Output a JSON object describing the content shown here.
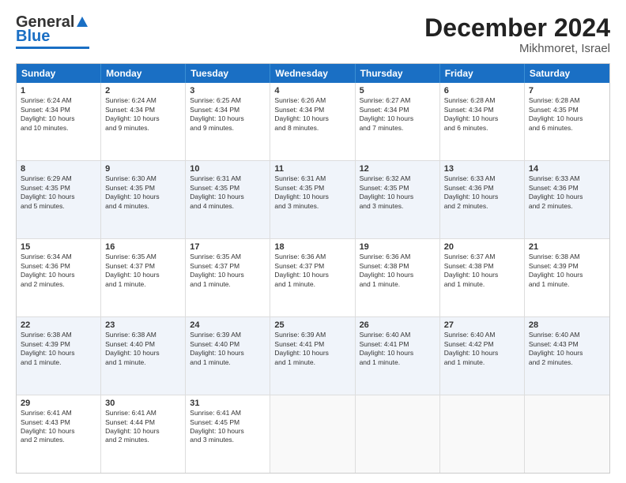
{
  "header": {
    "logo_general": "General",
    "logo_blue": "Blue",
    "title": "December 2024",
    "location": "Mikhmoret, Israel"
  },
  "days_of_week": [
    "Sunday",
    "Monday",
    "Tuesday",
    "Wednesday",
    "Thursday",
    "Friday",
    "Saturday"
  ],
  "weeks": [
    [
      {
        "day": "1",
        "sunrise": "6:24 AM",
        "sunset": "4:34 PM",
        "daylight": "10 hours and 10 minutes."
      },
      {
        "day": "2",
        "sunrise": "6:24 AM",
        "sunset": "4:34 PM",
        "daylight": "10 hours and 9 minutes."
      },
      {
        "day": "3",
        "sunrise": "6:25 AM",
        "sunset": "4:34 PM",
        "daylight": "10 hours and 9 minutes."
      },
      {
        "day": "4",
        "sunrise": "6:26 AM",
        "sunset": "4:34 PM",
        "daylight": "10 hours and 8 minutes."
      },
      {
        "day": "5",
        "sunrise": "6:27 AM",
        "sunset": "4:34 PM",
        "daylight": "10 hours and 7 minutes."
      },
      {
        "day": "6",
        "sunrise": "6:28 AM",
        "sunset": "4:34 PM",
        "daylight": "10 hours and 6 minutes."
      },
      {
        "day": "7",
        "sunrise": "6:28 AM",
        "sunset": "4:35 PM",
        "daylight": "10 hours and 6 minutes."
      }
    ],
    [
      {
        "day": "8",
        "sunrise": "6:29 AM",
        "sunset": "4:35 PM",
        "daylight": "10 hours and 5 minutes."
      },
      {
        "day": "9",
        "sunrise": "6:30 AM",
        "sunset": "4:35 PM",
        "daylight": "10 hours and 4 minutes."
      },
      {
        "day": "10",
        "sunrise": "6:31 AM",
        "sunset": "4:35 PM",
        "daylight": "10 hours and 4 minutes."
      },
      {
        "day": "11",
        "sunrise": "6:31 AM",
        "sunset": "4:35 PM",
        "daylight": "10 hours and 3 minutes."
      },
      {
        "day": "12",
        "sunrise": "6:32 AM",
        "sunset": "4:35 PM",
        "daylight": "10 hours and 3 minutes."
      },
      {
        "day": "13",
        "sunrise": "6:33 AM",
        "sunset": "4:36 PM",
        "daylight": "10 hours and 2 minutes."
      },
      {
        "day": "14",
        "sunrise": "6:33 AM",
        "sunset": "4:36 PM",
        "daylight": "10 hours and 2 minutes."
      }
    ],
    [
      {
        "day": "15",
        "sunrise": "6:34 AM",
        "sunset": "4:36 PM",
        "daylight": "10 hours and 2 minutes."
      },
      {
        "day": "16",
        "sunrise": "6:35 AM",
        "sunset": "4:37 PM",
        "daylight": "10 hours and 1 minute."
      },
      {
        "day": "17",
        "sunrise": "6:35 AM",
        "sunset": "4:37 PM",
        "daylight": "10 hours and 1 minute."
      },
      {
        "day": "18",
        "sunrise": "6:36 AM",
        "sunset": "4:37 PM",
        "daylight": "10 hours and 1 minute."
      },
      {
        "day": "19",
        "sunrise": "6:36 AM",
        "sunset": "4:38 PM",
        "daylight": "10 hours and 1 minute."
      },
      {
        "day": "20",
        "sunrise": "6:37 AM",
        "sunset": "4:38 PM",
        "daylight": "10 hours and 1 minute."
      },
      {
        "day": "21",
        "sunrise": "6:38 AM",
        "sunset": "4:39 PM",
        "daylight": "10 hours and 1 minute."
      }
    ],
    [
      {
        "day": "22",
        "sunrise": "6:38 AM",
        "sunset": "4:39 PM",
        "daylight": "10 hours and 1 minute."
      },
      {
        "day": "23",
        "sunrise": "6:38 AM",
        "sunset": "4:40 PM",
        "daylight": "10 hours and 1 minute."
      },
      {
        "day": "24",
        "sunrise": "6:39 AM",
        "sunset": "4:40 PM",
        "daylight": "10 hours and 1 minute."
      },
      {
        "day": "25",
        "sunrise": "6:39 AM",
        "sunset": "4:41 PM",
        "daylight": "10 hours and 1 minute."
      },
      {
        "day": "26",
        "sunrise": "6:40 AM",
        "sunset": "4:41 PM",
        "daylight": "10 hours and 1 minute."
      },
      {
        "day": "27",
        "sunrise": "6:40 AM",
        "sunset": "4:42 PM",
        "daylight": "10 hours and 1 minute."
      },
      {
        "day": "28",
        "sunrise": "6:40 AM",
        "sunset": "4:43 PM",
        "daylight": "10 hours and 2 minutes."
      }
    ],
    [
      {
        "day": "29",
        "sunrise": "6:41 AM",
        "sunset": "4:43 PM",
        "daylight": "10 hours and 2 minutes."
      },
      {
        "day": "30",
        "sunrise": "6:41 AM",
        "sunset": "4:44 PM",
        "daylight": "10 hours and 2 minutes."
      },
      {
        "day": "31",
        "sunrise": "6:41 AM",
        "sunset": "4:45 PM",
        "daylight": "10 hours and 3 minutes."
      },
      null,
      null,
      null,
      null
    ]
  ],
  "labels": {
    "sunrise_prefix": "Sunrise: ",
    "sunset_prefix": "Sunset: ",
    "daylight_prefix": "Daylight: "
  }
}
